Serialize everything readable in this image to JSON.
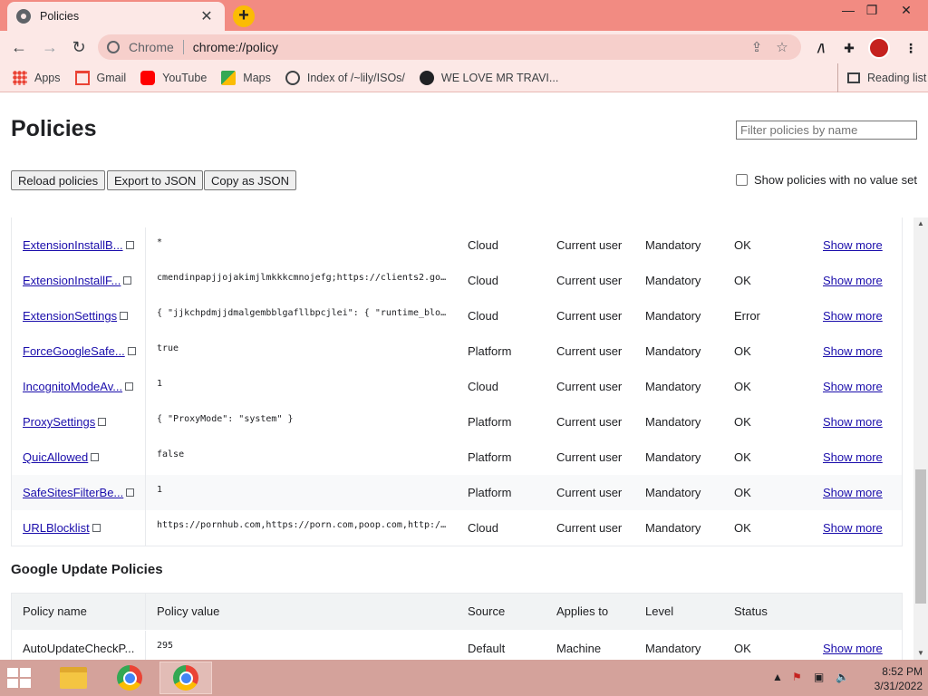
{
  "browser": {
    "tab_title": "Policies",
    "tab_close": "✕",
    "new_tab": "+",
    "window_controls": [
      "—",
      "❐",
      "✕"
    ],
    "omnibox_scheme": "Chrome",
    "omnibox_url": "chrome://policy"
  },
  "bookmarks": [
    {
      "label": "Apps",
      "icon": "apps-grid-icon"
    },
    {
      "label": "Gmail",
      "icon": "gmail-icon"
    },
    {
      "label": "YouTube",
      "icon": "youtube-icon"
    },
    {
      "label": "Maps",
      "icon": "maps-icon"
    },
    {
      "label": "Index of /~lily/ISOs/",
      "icon": "site-icon"
    },
    {
      "label": "WE LOVE MR TRAVI...",
      "icon": "globe-icon"
    }
  ],
  "reading_list": "Reading list",
  "page": {
    "title": "Policies",
    "filter_placeholder": "Filter policies by name",
    "reload_button": "Reload policies",
    "export_button": "Export to JSON",
    "copy_button": "Copy as JSON",
    "show_no_value_label": "Show policies with no value set"
  },
  "policies": [
    {
      "name": "ExtensionInstallB...",
      "value": "*",
      "source": "Cloud",
      "applies_to": "Current user",
      "level": "Mandatory",
      "status": "OK",
      "more": "Show more"
    },
    {
      "name": "ExtensionInstallF...",
      "value": "cmendinpapjjojakimjlmkkkcmnojefg;https://clients2.goog...",
      "source": "Cloud",
      "applies_to": "Current user",
      "level": "Mandatory",
      "status": "OK",
      "more": "Show more"
    },
    {
      "name": "ExtensionSettings",
      "value": "{ \"jjkchpdmjjdmalgembblgafllbpcjlei\": { \"runtime_block...",
      "source": "Cloud",
      "applies_to": "Current user",
      "level": "Mandatory",
      "status": "Error",
      "more": "Show more"
    },
    {
      "name": "ForceGoogleSafe...",
      "value": "true",
      "source": "Platform",
      "applies_to": "Current user",
      "level": "Mandatory",
      "status": "OK",
      "more": "Show more"
    },
    {
      "name": "IncognitoModeAv...",
      "value": "1",
      "source": "Cloud",
      "applies_to": "Current user",
      "level": "Mandatory",
      "status": "OK",
      "more": "Show more"
    },
    {
      "name": "ProxySettings",
      "value": "{ \"ProxyMode\": \"system\" }",
      "source": "Platform",
      "applies_to": "Current user",
      "level": "Mandatory",
      "status": "OK",
      "more": "Show more"
    },
    {
      "name": "QuicAllowed",
      "value": "false",
      "source": "Platform",
      "applies_to": "Current user",
      "level": "Mandatory",
      "status": "OK",
      "more": "Show more"
    },
    {
      "name": "SafeSitesFilterBe...",
      "value": "1",
      "source": "Platform",
      "applies_to": "Current user",
      "level": "Mandatory",
      "status": "OK",
      "more": "Show more"
    },
    {
      "name": "URLBlocklist",
      "value": "https://pornhub.com,https://porn.com,poop.com,http://r...",
      "source": "Cloud",
      "applies_to": "Current user",
      "level": "Mandatory",
      "status": "OK",
      "more": "Show more"
    }
  ],
  "google_update": {
    "title": "Google Update Policies",
    "headers": [
      "Policy name",
      "Policy value",
      "Source",
      "Applies to",
      "Level",
      "Status"
    ],
    "rows": [
      {
        "name": "AutoUpdateCheckP...",
        "value": "295",
        "source": "Default",
        "applies_to": "Machine",
        "level": "Mandatory",
        "status": "OK",
        "more": "Show more"
      }
    ]
  },
  "taskbar": {
    "time": "8:52 PM",
    "date": "3/31/2022"
  }
}
